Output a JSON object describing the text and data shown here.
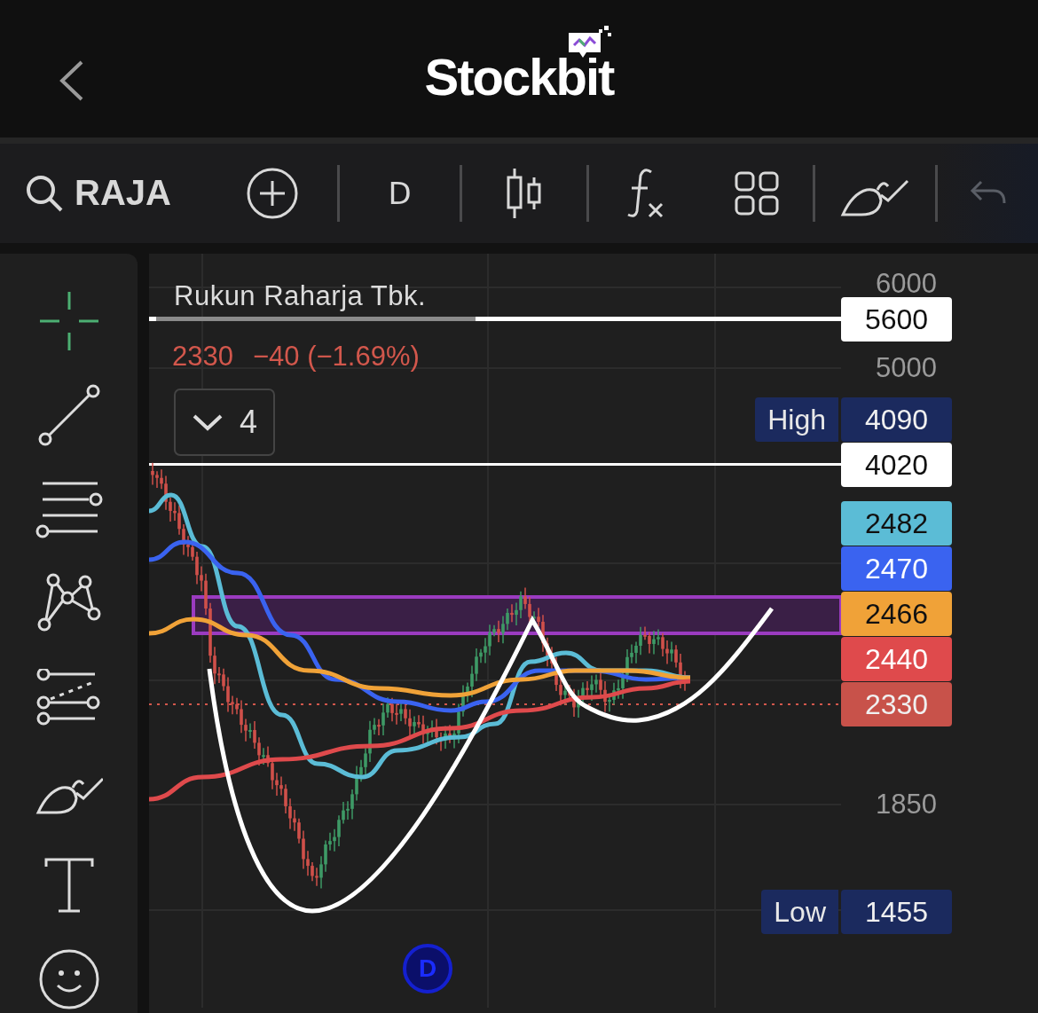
{
  "header": {
    "logo": "Stockbit"
  },
  "toolbar": {
    "symbol": "RAJA",
    "interval": "D"
  },
  "tools": [
    {
      "kind": "crosshair",
      "selected": true
    },
    {
      "kind": "line",
      "selected": false
    },
    {
      "kind": "hlines",
      "selected": false
    },
    {
      "kind": "pattern",
      "selected": false
    },
    {
      "kind": "channel",
      "selected": false
    },
    {
      "kind": "brush",
      "selected": false
    },
    {
      "kind": "text",
      "selected": false
    },
    {
      "kind": "emoji",
      "selected": false
    }
  ],
  "chart": {
    "title": "Rukun Raharja Tbk.",
    "last": "2330",
    "change": "−40 (−1.69%)",
    "indicator_count": "4",
    "axis_labels": [
      "6000",
      "5000",
      "1850"
    ],
    "price_tags": [
      {
        "kind": "line",
        "label": "5600",
        "color": "#ffffff"
      },
      {
        "kind": "extreme",
        "caption": "High",
        "label": "4090",
        "color": "#1b2a5e"
      },
      {
        "kind": "line",
        "label": "4020",
        "color": "#ffffff"
      },
      {
        "kind": "ma",
        "label": "2482",
        "color": "#5bbcd6"
      },
      {
        "kind": "ma",
        "label": "2470",
        "color": "#3a63f0"
      },
      {
        "kind": "ma",
        "label": "2466",
        "color": "#f0a238"
      },
      {
        "kind": "ma",
        "label": "2440",
        "color": "#df4a4c"
      },
      {
        "kind": "last",
        "label": "2330",
        "color": "#c8524a"
      },
      {
        "kind": "extreme",
        "caption": "Low",
        "label": "1455",
        "color": "#1b2a5e"
      }
    ],
    "event_marker": "D"
  }
}
